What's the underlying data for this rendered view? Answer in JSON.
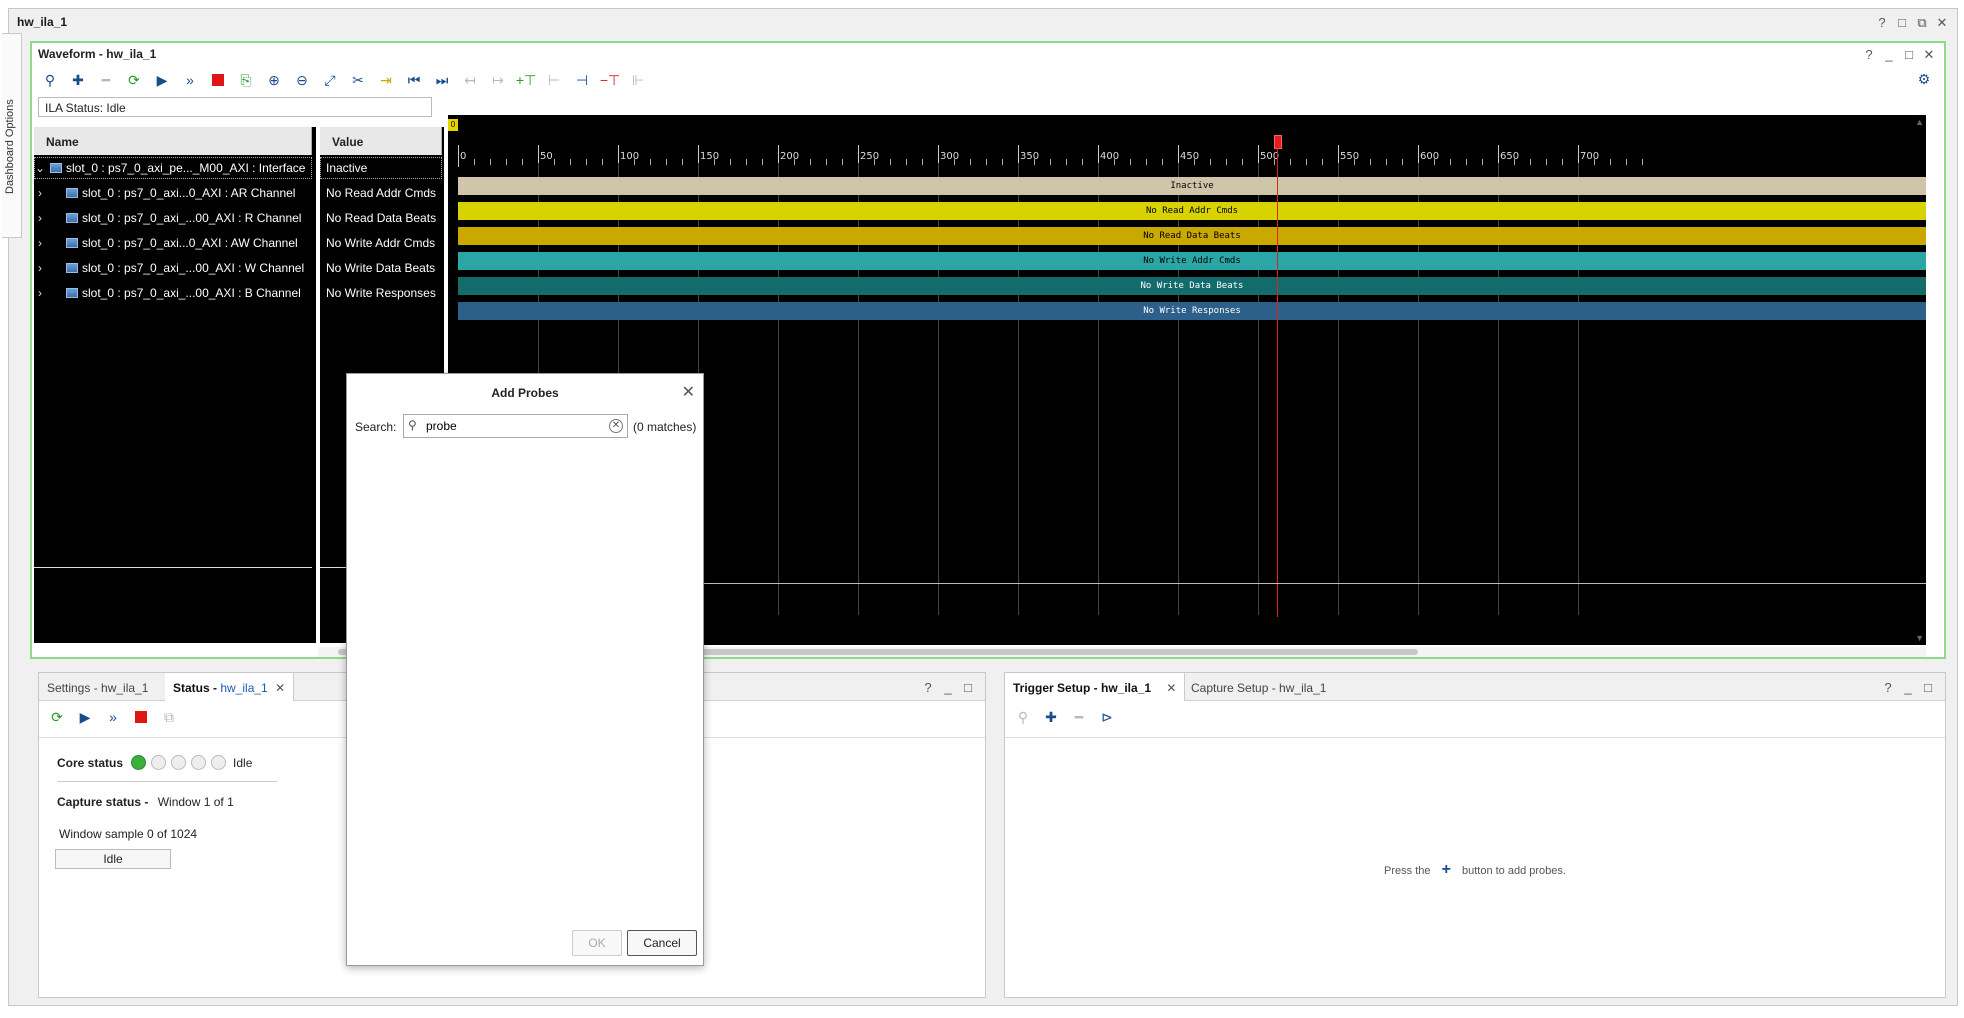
{
  "window": {
    "title": "hw_ila_1",
    "controls": [
      "?",
      "□",
      "⧉",
      "✕"
    ]
  },
  "side_tab": {
    "label": "Dashboard Options"
  },
  "waveform": {
    "title": "Waveform - hw_ila_1",
    "controls": [
      "?",
      "_",
      "□",
      "✕"
    ],
    "ila_status": "ILA Status:  Idle",
    "headers": {
      "name": "Name",
      "value": "Value"
    },
    "rows": [
      {
        "name": "slot_0 : ps7_0_axi_pe..._M00_AXI : Interface",
        "value": "Inactive",
        "wave": "Inactive",
        "color": "#cfc6a9",
        "text_color": "#000000"
      },
      {
        "name": "slot_0 : ps7_0_axi...0_AXI : AR Channel",
        "value": "No Read Addr Cmds",
        "wave": "No Read Addr Cmds",
        "color": "#d7d200",
        "text_color": "#000000"
      },
      {
        "name": "slot_0 : ps7_0_axi_...00_AXI : R Channel",
        "value": "No Read Data Beats",
        "wave": "No Read Data Beats",
        "color": "#c9a800",
        "text_color": "#000000"
      },
      {
        "name": "slot_0 : ps7_0_axi...0_AXI : AW Channel",
        "value": "No Write Addr Cmds",
        "wave": "No Write Addr Cmds",
        "color": "#2aa6a6",
        "text_color": "#000000"
      },
      {
        "name": "slot_0 : ps7_0_axi_...00_AXI : W Channel",
        "value": "No Write Data Beats",
        "wave": "No Write Data Beats",
        "color": "#146b6b",
        "text_color": "#ffffff"
      },
      {
        "name": "slot_0 : ps7_0_axi_...00_AXI : B Channel",
        "value": "No Write Responses",
        "wave": "No Write Responses",
        "color": "#2c5f8a",
        "text_color": "#ffffff"
      }
    ],
    "ticks": [
      "0",
      "50",
      "100",
      "150",
      "200",
      "250",
      "300",
      "350",
      "400",
      "450",
      "500",
      "550",
      "600",
      "650",
      "700"
    ],
    "zero_marker": "0",
    "cursor_value": 512
  },
  "status_panel": {
    "tabs": [
      {
        "label": "Settings - hw_ila_1"
      },
      {
        "label": "Status - ",
        "sub": "hw_ila_1"
      }
    ],
    "controls": [
      "?",
      "_",
      "□"
    ],
    "core_status_label": "Core status",
    "core_status_text": "Idle",
    "capture_status_label": "Capture status -",
    "capture_status_text": "Window 1 of 1",
    "window_sample": "Window sample 0 of 1024",
    "idle_button": "Idle"
  },
  "trigger_panel": {
    "tabs": [
      {
        "label": "Trigger Setup - hw_ila_1"
      },
      {
        "label": "Capture Setup - hw_ila_1"
      }
    ],
    "controls": [
      "?",
      "_",
      "□"
    ],
    "hint_before": "Press the",
    "hint_after": "button to add probes."
  },
  "modal": {
    "title": "Add Probes",
    "search_label": "Search:",
    "search_value": "probe",
    "matches": "(0 matches)",
    "ok": "OK",
    "cancel": "Cancel"
  },
  "colors": {
    "accent_green": "#8fd98b",
    "cursor_red": "#e02020",
    "status_green": "#3cae3c"
  }
}
